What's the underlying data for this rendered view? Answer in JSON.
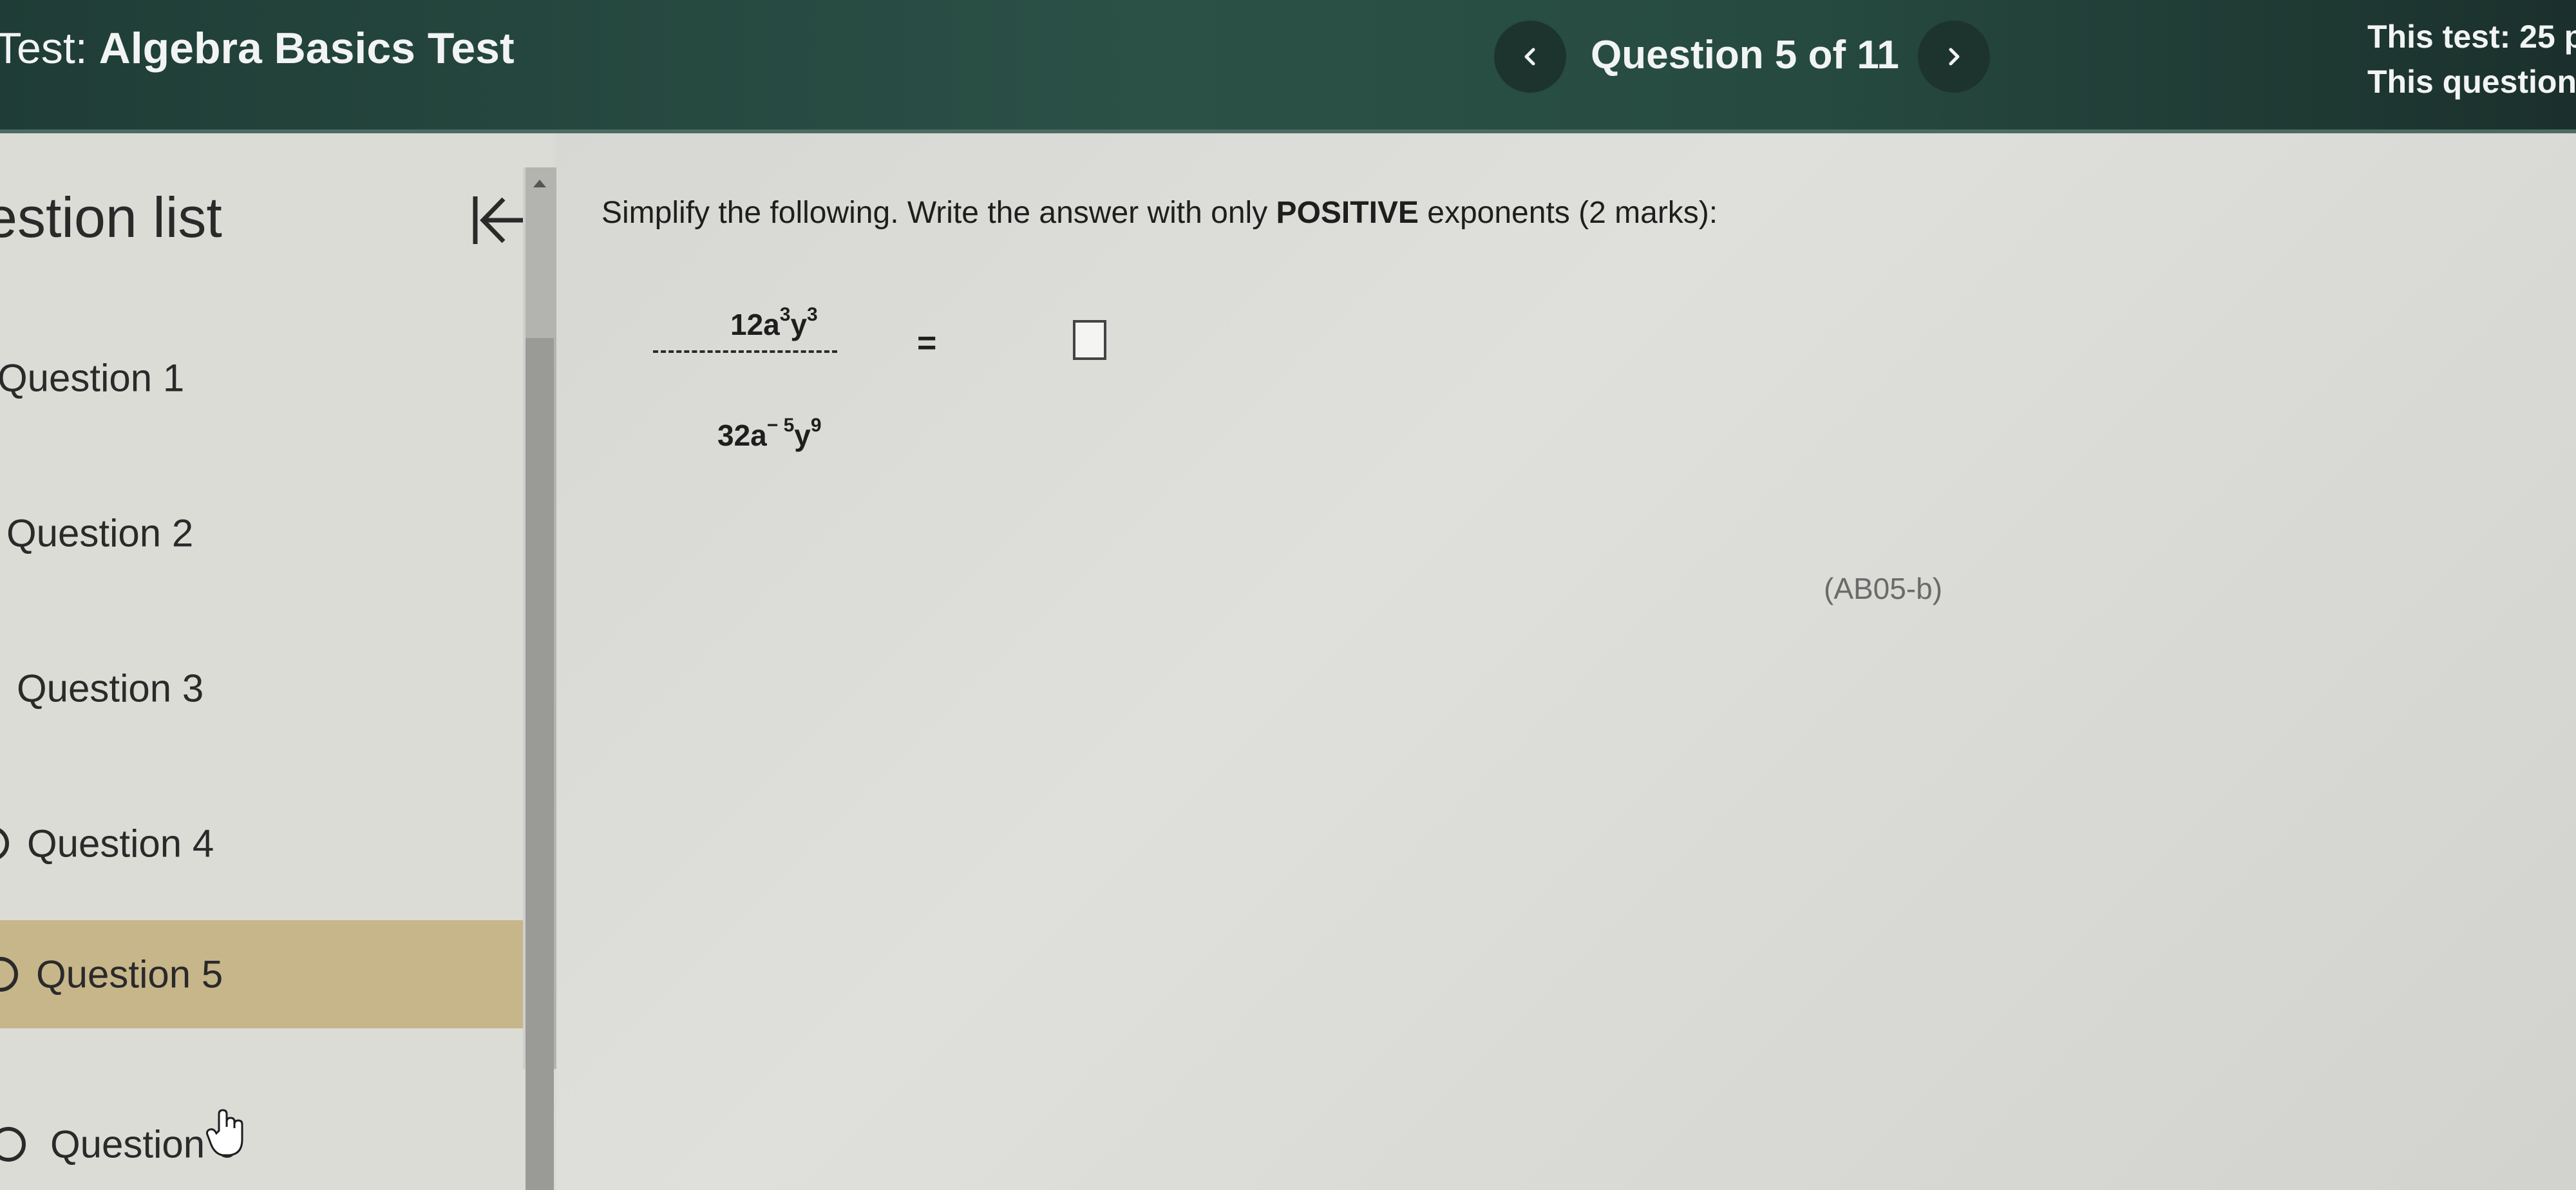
{
  "header": {
    "test_prefix": "Test:",
    "test_name": "Algebra Basics Test",
    "prev_icon": "chevron-left-icon",
    "next_icon": "chevron-right-icon",
    "question_indicator": "Question 5 of 11",
    "this_test_label": "This test: 25 p",
    "this_question_label": "This question"
  },
  "sidebar": {
    "title": "estion list",
    "collapse_icon": "collapse-left-icon",
    "items": [
      {
        "label": "Question 1"
      },
      {
        "label": "Question 2"
      },
      {
        "label": "Question 3"
      },
      {
        "label": "Question 4"
      },
      {
        "label": "Question 5",
        "active": true
      },
      {
        "label": "Question 6"
      }
    ]
  },
  "question": {
    "instruction_prefix": "Simplify the following.  Write the answer with only ",
    "instruction_bold": "POSITIVE",
    "instruction_suffix": " exponents (2 marks):",
    "numerator": {
      "coef": "12a",
      "exp1": "3",
      "var2": "y",
      "exp2": "3"
    },
    "denominator": {
      "coef": "32a",
      "exp1": "− 5",
      "var2": "y",
      "exp2": "9"
    },
    "equals": "=",
    "code": "(AB05-b)"
  },
  "colors": {
    "header_bg": "#2b5147",
    "active_item_bg": "#c7b68a"
  }
}
